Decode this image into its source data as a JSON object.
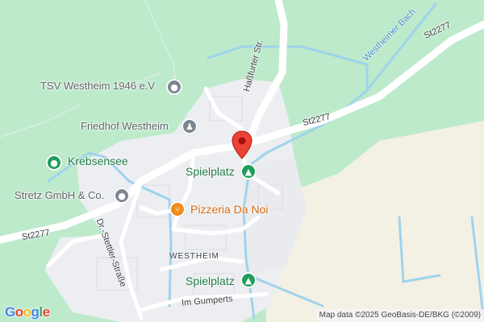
{
  "colors": {
    "forest": "#bdeacb",
    "built_area": "#f1f2f4",
    "farmland": "#f3f1e4",
    "road": "#ffffff",
    "water": "#9fd3ec",
    "pin": "#ea4335"
  },
  "pois": [
    {
      "label": "TSV Westheim 1946 e.V",
      "icon": "sports-club-icon",
      "style": "grey"
    },
    {
      "label": "Friedhof Westheim",
      "icon": "cemetery-icon",
      "style": "grey"
    },
    {
      "label": "Krebsensee",
      "icon": "lake-icon",
      "style": "green"
    },
    {
      "label": "Spielplatz",
      "icon": "playground-tree-icon",
      "style": "green"
    },
    {
      "label": "Stretz GmbH & Co.",
      "icon": "business-icon",
      "style": "grey"
    },
    {
      "label": "Pizzeria Da Noi",
      "icon": "restaurant-icon",
      "style": "orange"
    },
    {
      "label": "Spielplatz",
      "icon": "playground-tree-icon",
      "style": "green"
    }
  ],
  "roads": {
    "st2277_east": "St2277",
    "st2277_mid": "St2277",
    "st2277_west": "St2277",
    "hassfurter": "Haßfurter Str.",
    "dr_stettler": "Dr.-Stettler-Straße",
    "im_gumperts": "Im Gumperts"
  },
  "water_labels": {
    "westheimer_bach": "Westheimer Bach"
  },
  "place_label": "WESTHEIM",
  "branding": {
    "logo_letters": [
      "G",
      "o",
      "o",
      "g",
      "l",
      "e"
    ],
    "logo_colors": [
      "#4285F4",
      "#EA4335",
      "#FBBC05",
      "#4285F4",
      "#34A853",
      "#EA4335"
    ]
  },
  "attribution": "Map data ©2025 GeoBasis-DE/BKG (©2009)"
}
